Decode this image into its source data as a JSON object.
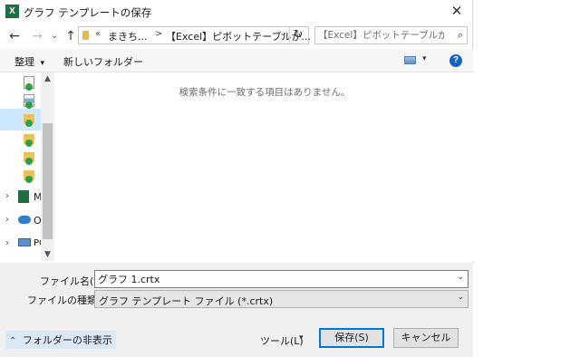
{
  "window": {
    "title": "グラフ テンプレートの保存",
    "app_icon_letter": "X",
    "close_glyph": "✕"
  },
  "nav": {
    "back_glyph": "←",
    "forward_glyph": "→",
    "dropdown_glyph": "⌄",
    "up_glyph": "↑",
    "address": {
      "overflow": "«",
      "crumbs": [
        "まきち...",
        "【Excel】ピボットテーブルか..."
      ],
      "separator": ">",
      "dropdown_glyph": "⌄",
      "refresh_glyph": "↻"
    },
    "search": {
      "placeholder": "【Excel】ピボットテーブルからグラフを...",
      "icon_glyph": "⌕"
    }
  },
  "toolbar": {
    "organize_label": "整理",
    "organize_caret": "▾",
    "new_folder_label": "新しいフォルダー",
    "view_caret": "▾",
    "help_glyph": "?"
  },
  "navpane": {
    "items": [
      {
        "label": "",
        "icon": "document-icon",
        "status": "synced"
      },
      {
        "label": "",
        "icon": "image-document-icon",
        "status": "synced"
      },
      {
        "label": "",
        "icon": "folder-icon",
        "status": "synced",
        "selected": true
      },
      {
        "label": "",
        "icon": "folder-icon",
        "status": "synced"
      },
      {
        "label": "",
        "icon": "folder-icon",
        "status": "synced"
      },
      {
        "label": "",
        "icon": "folder-icon",
        "status": "synced"
      },
      {
        "label": "M",
        "icon": "excel-icon",
        "expander": "›"
      },
      {
        "label": "O",
        "icon": "onedrive-icon",
        "expander": "›"
      },
      {
        "label": "PC",
        "icon": "pc-icon",
        "expander": "›"
      }
    ],
    "scroll_up_glyph": "▲",
    "scroll_down_glyph": "▼"
  },
  "content": {
    "empty_message": "検索条件に一致する項目はありません。"
  },
  "form": {
    "file_name_label": "ファイル名(N):",
    "file_name_value": "グラフ 1.crtx",
    "file_type_label": "ファイルの種類(T):",
    "file_type_value": "グラフ テンプレート ファイル (*.crtx)",
    "dropdown_glyph": "⌄"
  },
  "footer": {
    "hide_folders_label": "フォルダーの非表示",
    "hide_folders_glyph": "⌃",
    "tools_label": "ツール(L)",
    "tools_caret": "▾",
    "save_label": "保存(S)",
    "cancel_label": "キャンセル"
  },
  "colors": {
    "accent": "#0078d7",
    "selection": "#cce8ff",
    "excel_green": "#1d6f42",
    "sync_green": "#2ea043"
  }
}
